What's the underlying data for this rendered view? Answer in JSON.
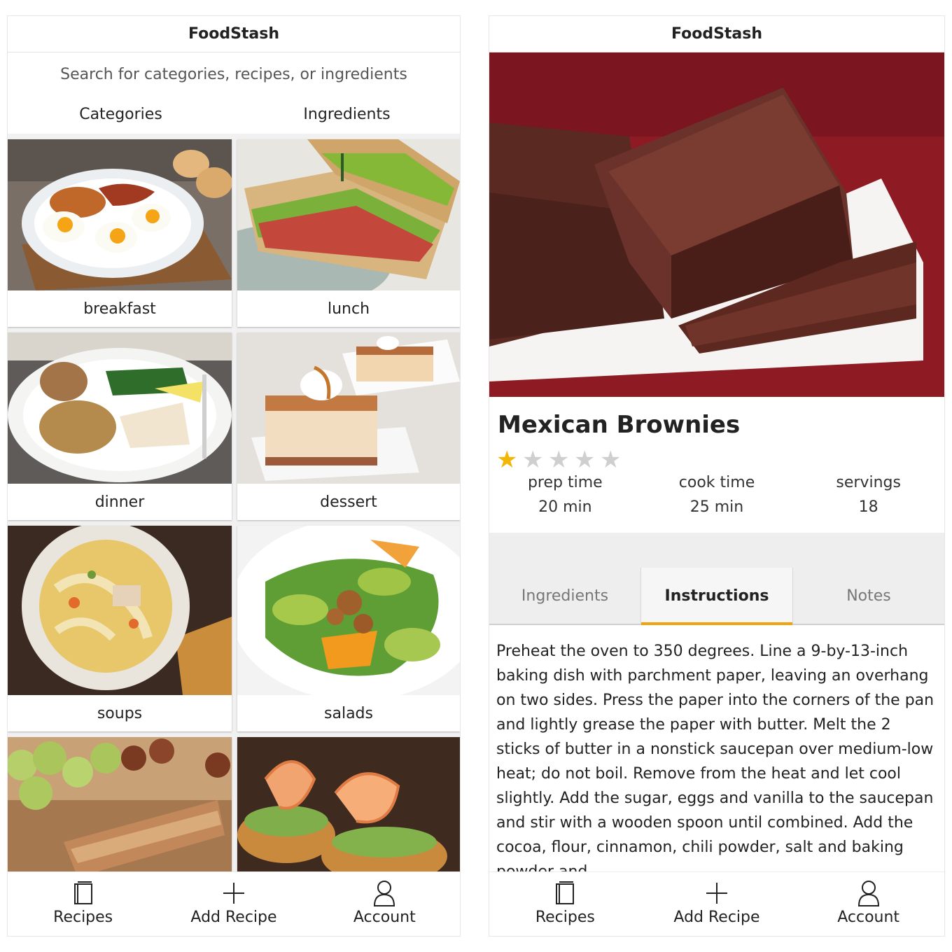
{
  "left": {
    "header": {
      "title": "FoodStash"
    },
    "search": {
      "placeholder": "Search for categories, recipes, or ingredients"
    },
    "segments": [
      "Categories",
      "Ingredients"
    ],
    "categories": [
      {
        "label": "breakfast",
        "icon": "breakfast-plate-photo"
      },
      {
        "label": "lunch",
        "icon": "sandwich-photo"
      },
      {
        "label": "dinner",
        "icon": "dinner-plate-photo"
      },
      {
        "label": "dessert",
        "icon": "dessert-bar-photo"
      },
      {
        "label": "soups",
        "icon": "soup-bowl-photo"
      },
      {
        "label": "salads",
        "icon": "salad-photo"
      },
      {
        "label": "",
        "icon": "granola-bar-photo"
      },
      {
        "label": "",
        "icon": "shrimp-appetizer-photo"
      }
    ],
    "tabs": [
      {
        "label": "Recipes",
        "icon": "book-icon"
      },
      {
        "label": "Add Recipe",
        "icon": "plus-icon"
      },
      {
        "label": "Account",
        "icon": "person-icon"
      }
    ]
  },
  "right": {
    "header": {
      "title": "FoodStash"
    },
    "recipe": {
      "title": "Mexican Brownies",
      "rating": 1,
      "rating_max": 5,
      "prep_label": "prep time",
      "prep_value": "20 min",
      "cook_label": "cook time",
      "cook_value": "25 min",
      "servings_label": "servings",
      "servings_value": "18"
    },
    "detail_tabs": [
      "Ingredients",
      "Instructions",
      "Notes"
    ],
    "active_tab": "Instructions",
    "instructions": "Preheat the oven to 350 degrees. Line a 9-by-13-inch baking dish with parchment paper, leaving an overhang on two sides. Press the paper into the corners of the pan and lightly grease the paper with butter. Melt the 2 sticks of butter in a nonstick saucepan over medium-low heat; do not boil. Remove from the heat and let cool slightly. Add the sugar, eggs and vanilla to the saucepan and stir with a wooden spoon until combined. Add the cocoa, flour, cinnamon, chili powder, salt and baking powder and",
    "tabs": [
      {
        "label": "Recipes",
        "icon": "book-icon"
      },
      {
        "label": "Add Recipe",
        "icon": "plus-icon"
      },
      {
        "label": "Account",
        "icon": "person-icon"
      }
    ]
  },
  "colors": {
    "accent": "#f2a20c",
    "star": "#f2b705",
    "brownie_bg": "#8e1a24"
  }
}
